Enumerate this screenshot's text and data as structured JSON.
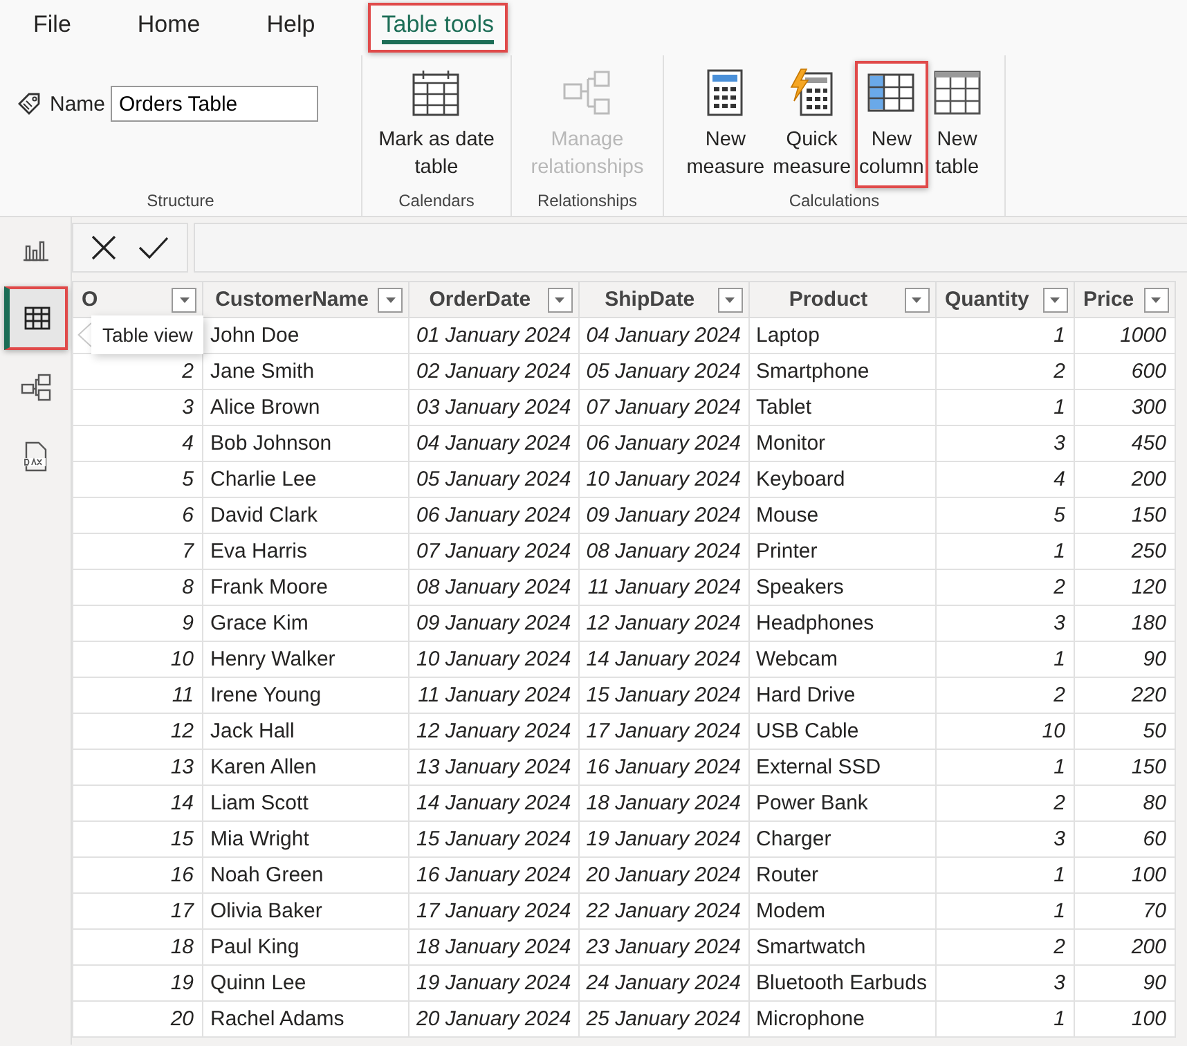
{
  "menu_tabs": [
    {
      "label": "File",
      "selected": false,
      "highlighted": false
    },
    {
      "label": "Home",
      "selected": false,
      "highlighted": false
    },
    {
      "label": "Help",
      "selected": false,
      "highlighted": false
    },
    {
      "label": "Table tools",
      "selected": true,
      "highlighted": true
    }
  ],
  "ribbon_groups": [
    {
      "title": "Structure",
      "kind": "name",
      "name_label": "Name",
      "name_value": "Orders Table"
    },
    {
      "title": "Calendars",
      "kind": "buttons",
      "buttons": [
        {
          "lines": [
            "Mark as date",
            "table"
          ],
          "disabled": false,
          "highlighted": false
        }
      ]
    },
    {
      "title": "Relationships",
      "kind": "buttons",
      "buttons": [
        {
          "lines": [
            "Manage",
            "relationships"
          ],
          "disabled": true,
          "highlighted": false
        }
      ]
    },
    {
      "title": "Calculations",
      "kind": "buttons",
      "buttons": [
        {
          "lines": [
            "New",
            "measure"
          ],
          "disabled": false,
          "highlighted": false
        },
        {
          "lines": [
            "Quick",
            "measure"
          ],
          "disabled": false,
          "highlighted": false
        },
        {
          "lines": [
            "New",
            "column"
          ],
          "disabled": false,
          "highlighted": true
        },
        {
          "lines": [
            "New",
            "table"
          ],
          "disabled": false,
          "highlighted": false
        }
      ]
    }
  ],
  "sidebar": {
    "items": [
      {
        "selected": false,
        "highlighted": false
      },
      {
        "selected": true,
        "highlighted": true,
        "tooltip": "Table view"
      },
      {
        "selected": false,
        "highlighted": false
      },
      {
        "selected": false,
        "highlighted": false
      }
    ]
  },
  "table": {
    "columns": [
      {
        "label": "O",
        "kind": "number"
      },
      {
        "label": "CustomerName",
        "kind": "text"
      },
      {
        "label": "OrderDate",
        "kind": "date"
      },
      {
        "label": "ShipDate",
        "kind": "date"
      },
      {
        "label": "Product",
        "kind": "text"
      },
      {
        "label": "Quantity",
        "kind": "number"
      },
      {
        "label": "Price",
        "kind": "number"
      }
    ],
    "rows": [
      [
        null,
        "John Doe",
        "01 January 2024",
        "04 January 2024",
        "Laptop",
        "1",
        "1000"
      ],
      [
        "2",
        "Jane Smith",
        "02 January 2024",
        "05 January 2024",
        "Smartphone",
        "2",
        "600"
      ],
      [
        "3",
        "Alice Brown",
        "03 January 2024",
        "07 January 2024",
        "Tablet",
        "1",
        "300"
      ],
      [
        "4",
        "Bob Johnson",
        "04 January 2024",
        "06 January 2024",
        "Monitor",
        "3",
        "450"
      ],
      [
        "5",
        "Charlie Lee",
        "05 January 2024",
        "10 January 2024",
        "Keyboard",
        "4",
        "200"
      ],
      [
        "6",
        "David Clark",
        "06 January 2024",
        "09 January 2024",
        "Mouse",
        "5",
        "150"
      ],
      [
        "7",
        "Eva Harris",
        "07 January 2024",
        "08 January 2024",
        "Printer",
        "1",
        "250"
      ],
      [
        "8",
        "Frank Moore",
        "08 January 2024",
        "11 January 2024",
        "Speakers",
        "2",
        "120"
      ],
      [
        "9",
        "Grace Kim",
        "09 January 2024",
        "12 January 2024",
        "Headphones",
        "3",
        "180"
      ],
      [
        "10",
        "Henry Walker",
        "10 January 2024",
        "14 January 2024",
        "Webcam",
        "1",
        "90"
      ],
      [
        "11",
        "Irene Young",
        "11 January 2024",
        "15 January 2024",
        "Hard Drive",
        "2",
        "220"
      ],
      [
        "12",
        "Jack Hall",
        "12 January 2024",
        "17 January 2024",
        "USB Cable",
        "10",
        "50"
      ],
      [
        "13",
        "Karen Allen",
        "13 January 2024",
        "16 January 2024",
        "External SSD",
        "1",
        "150"
      ],
      [
        "14",
        "Liam Scott",
        "14 January 2024",
        "18 January 2024",
        "Power Bank",
        "2",
        "80"
      ],
      [
        "15",
        "Mia Wright",
        "15 January 2024",
        "19 January 2024",
        "Charger",
        "3",
        "60"
      ],
      [
        "16",
        "Noah Green",
        "16 January 2024",
        "20 January 2024",
        "Router",
        "1",
        "100"
      ],
      [
        "17",
        "Olivia Baker",
        "17 January 2024",
        "22 January 2024",
        "Modem",
        "1",
        "70"
      ],
      [
        "18",
        "Paul King",
        "18 January 2024",
        "23 January 2024",
        "Smartwatch",
        "2",
        "200"
      ],
      [
        "19",
        "Quinn Lee",
        "19 January 2024",
        "24 January 2024",
        "Bluetooth Earbuds",
        "3",
        "90"
      ],
      [
        "20",
        "Rachel Adams",
        "20 January 2024",
        "25 January 2024",
        "Microphone",
        "1",
        "100"
      ]
    ]
  }
}
